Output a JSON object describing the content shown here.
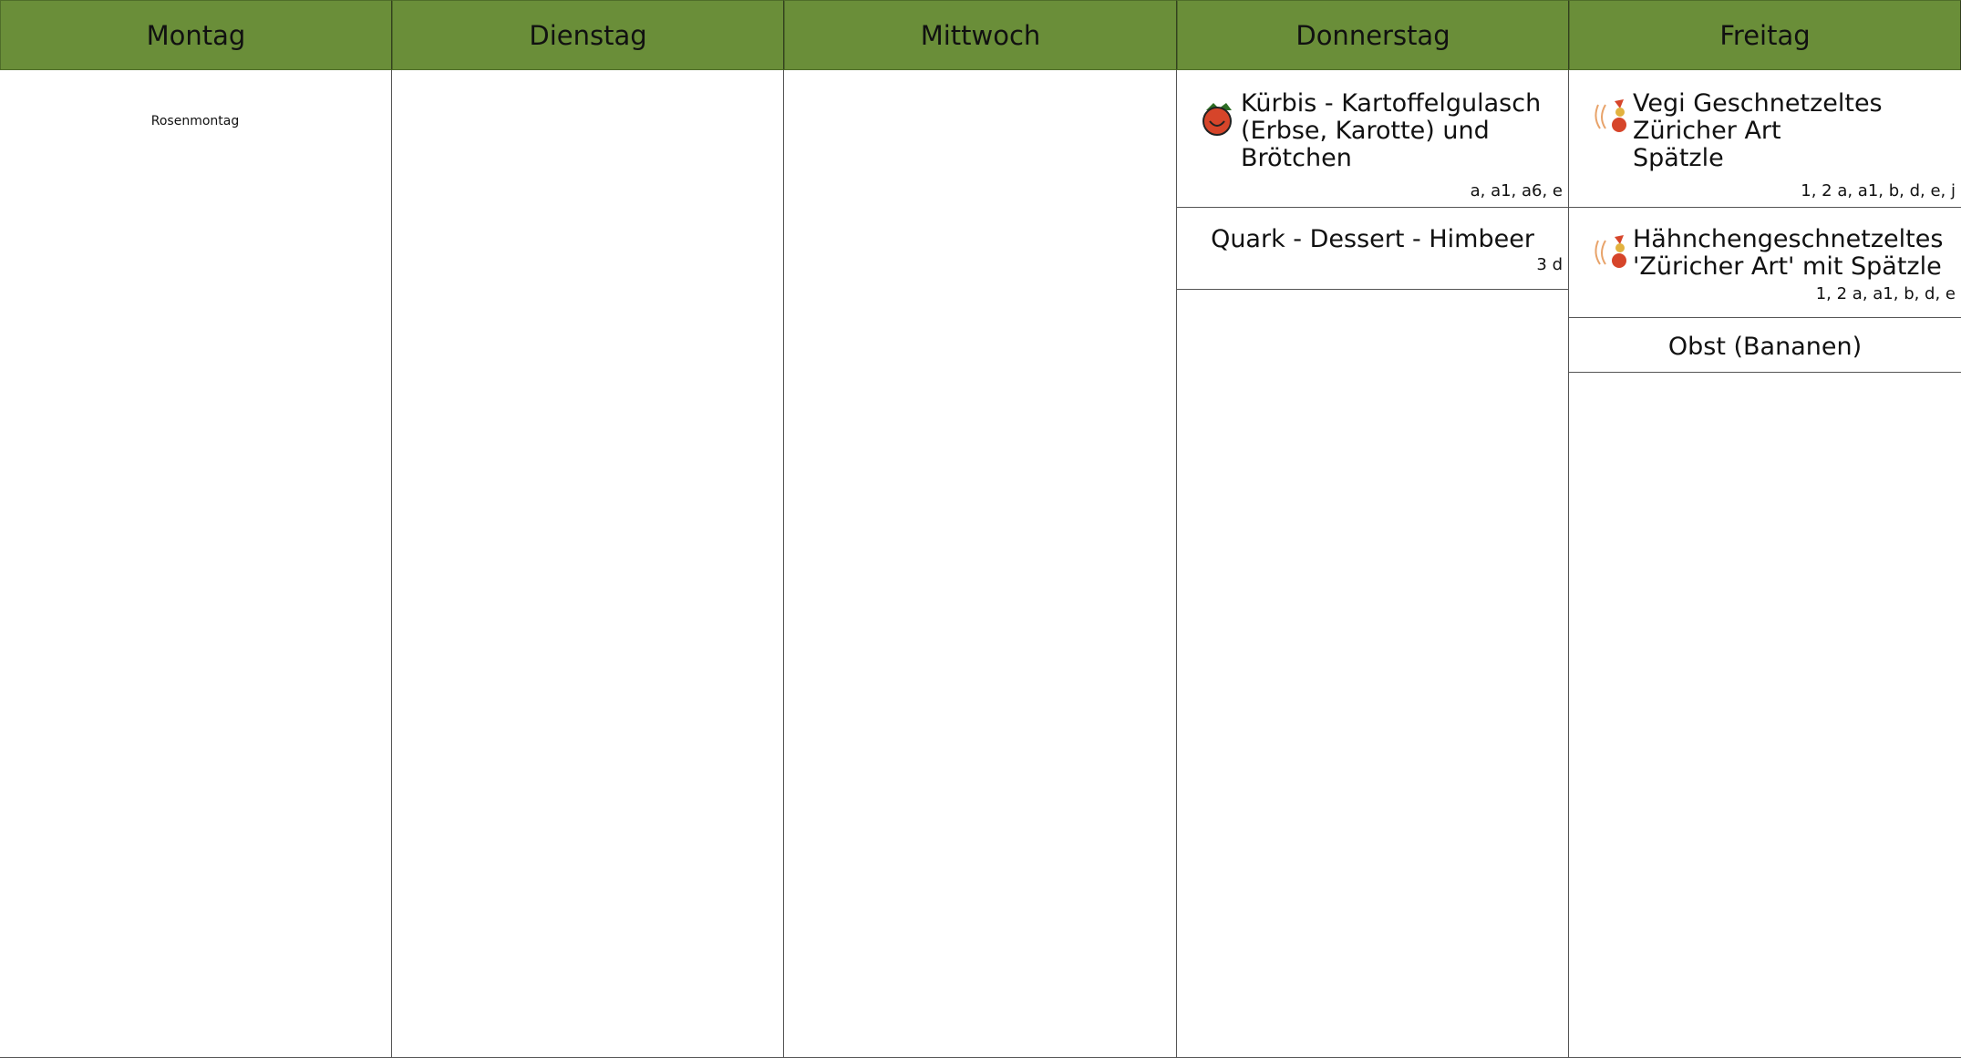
{
  "days": {
    "mon": "Montag",
    "tue": "Dienstag",
    "wed": "Mittwoch",
    "thu": "Donnerstag",
    "fri": "Freitag"
  },
  "monday": {
    "note": "Rosenmontag"
  },
  "thursday": {
    "meal1": {
      "title": "Kürbis - Kartoffelgulasch\n(Erbse, Karotte) und\nBrötchen",
      "allergens": "a, a1, a6, e",
      "icon": "tomato-icon"
    },
    "meal2": {
      "title": "Quark - Dessert - Himbeer",
      "allergens": "3 d"
    }
  },
  "friday": {
    "meal1": {
      "title": "Vegi Geschnetzeltes\nZüricher Art\nSpätzle",
      "allergens": "1, 2 a, a1, b, d, e, j",
      "icon": "chicken-tomato-icon"
    },
    "meal2": {
      "title": "Hähnchengeschnetzeltes\n'Züricher Art' mit Spätzle",
      "allergens": "1, 2 a, a1, b, d, e",
      "icon": "chicken-tomato-icon"
    },
    "meal3": {
      "title": "Obst (Bananen)"
    }
  },
  "colors": {
    "header": "#6a8e39",
    "line": "#555555"
  }
}
